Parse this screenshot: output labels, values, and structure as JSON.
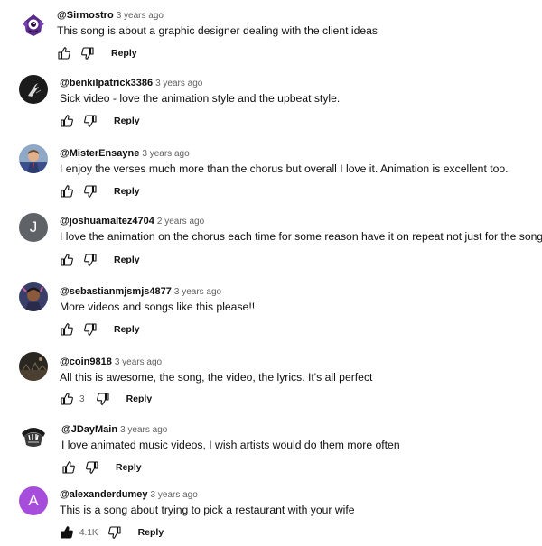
{
  "comments": [
    {
      "author": "@Sirmostro",
      "time": "3 years ago",
      "text": "This song is about a graphic designer dealing with the client ideas",
      "likes": "",
      "reply_label": "Reply",
      "avatar_icon": "purple-creature-avatar"
    },
    {
      "author": "@benkilpatrick3386",
      "time": "3 years ago",
      "text": "Sick video - love the animation style and the upbeat style.",
      "likes": "",
      "reply_label": "Reply",
      "avatar_icon": "dark-photo-avatar"
    },
    {
      "author": "@MisterEnsayne",
      "time": "3 years ago",
      "text": "I enjoy the verses much more than the chorus but overall I love it. Animation is excellent too.",
      "likes": "",
      "reply_label": "Reply",
      "avatar_icon": "person-photo-avatar"
    },
    {
      "author": "@joshuamaltez4704",
      "time": "2 years ago",
      "text": "I love the animation on the chorus each time for some reason have it on repeat not just for the song",
      "likes": "",
      "reply_label": "Reply",
      "avatar_letter": "J",
      "avatar_color": "#5f6368"
    },
    {
      "author": "@sebastianmjsmjs4877",
      "time": "3 years ago",
      "text": "More videos and songs like this please!!",
      "likes": "",
      "reply_label": "Reply",
      "avatar_icon": "person-photo-avatar"
    },
    {
      "author": "@coin9818",
      "time": "3 years ago",
      "text": "All this is awesome, the song, the video, the lyrics. It's all perfect",
      "likes": "3",
      "reply_label": "Reply",
      "avatar_icon": "dark-photo-avatar"
    },
    {
      "author": "@JDayMain",
      "time": "3 years ago",
      "text": "I love animated music videos, I wish artists would do them more often",
      "likes": "",
      "reply_label": "Reply",
      "avatar_icon": "logo-avatar"
    },
    {
      "author": "@alexanderdumey",
      "time": "3 years ago",
      "text": "This is a song about trying to pick a restaurant with your wife",
      "likes": "4.1K",
      "liked": true,
      "reply_label": "Reply",
      "avatar_letter": "A",
      "avatar_color": "#a64ddb"
    }
  ]
}
